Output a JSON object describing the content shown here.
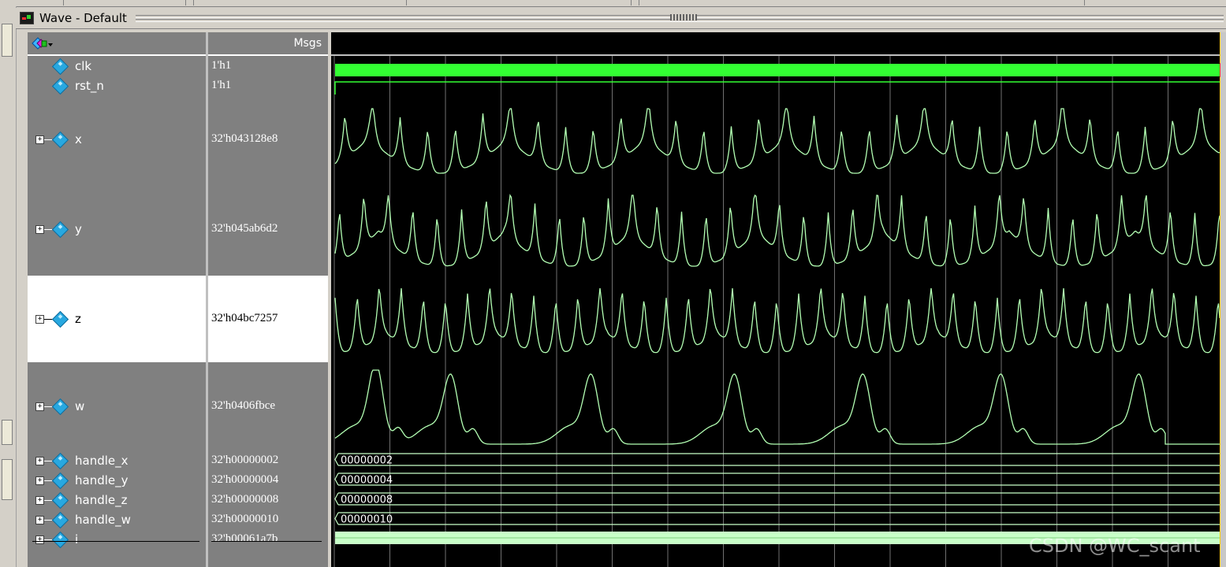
{
  "window": {
    "title": "Wave - Default"
  },
  "columns": {
    "msgs_label": "Msgs"
  },
  "signals": [
    {
      "name": "clk",
      "value": "1'h1",
      "expandable": false,
      "selected": false
    },
    {
      "name": "rst_n",
      "value": "1'h1",
      "expandable": false,
      "selected": false
    },
    {
      "name": "x",
      "value": "32'h043128e8",
      "expandable": true,
      "selected": false
    },
    {
      "name": "y",
      "value": "32'h045ab6d2",
      "expandable": true,
      "selected": false
    },
    {
      "name": "z",
      "value": "32'h04bc7257",
      "expandable": true,
      "selected": true
    },
    {
      "name": "w",
      "value": "32'h0406fbce",
      "expandable": true,
      "selected": false
    },
    {
      "name": "handle_x",
      "value": "32'h00000002",
      "bus_text": "00000002",
      "expandable": true,
      "selected": false
    },
    {
      "name": "handle_y",
      "value": "32'h00000004",
      "bus_text": "00000004",
      "expandable": true,
      "selected": false
    },
    {
      "name": "handle_z",
      "value": "32'h00000008",
      "bus_text": "00000008",
      "expandable": true,
      "selected": false
    },
    {
      "name": "handle_w",
      "value": "32'h00000010",
      "bus_text": "00000010",
      "expandable": true,
      "selected": false
    },
    {
      "name": "i",
      "value": "32'h00061a7b",
      "expandable": true,
      "selected": false
    }
  ],
  "colors": {
    "clk": "#33ff33",
    "wave": "#b3ffb3",
    "bus": "#c8ffc8",
    "grid": "#a0a0a0",
    "cursor": "#ffd000",
    "cursor_marker": "#ff3030"
  },
  "watermark": "CSDN @WC_scant"
}
